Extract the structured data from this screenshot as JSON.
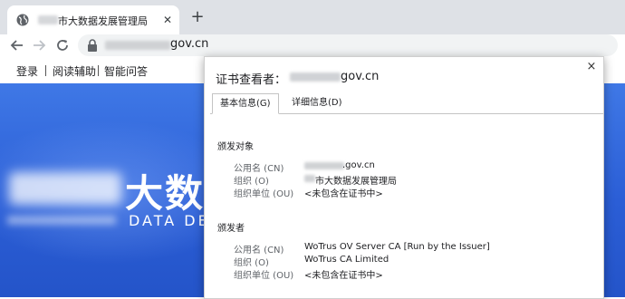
{
  "browser": {
    "tab": {
      "title": "市大数据发展管理局"
    },
    "new_tab_symbol": "+",
    "nav": {
      "back": "←",
      "forward": "→",
      "reload": "C"
    },
    "address": {
      "domain": "gov.cn"
    }
  },
  "page": {
    "topnav": [
      "登录",
      "阅读辅助",
      "智能问答"
    ],
    "hero": {
      "title": "大数",
      "subtitle": "DATA DEV"
    }
  },
  "cert_viewer": {
    "title_prefix": "证书查看者：",
    "title_domain": "gov.cn",
    "close": "×",
    "tabs": [
      {
        "label": "基本信息(G)",
        "active": true
      },
      {
        "label": "详细信息(D)",
        "active": false
      }
    ],
    "subject": {
      "section_title": "颁发对象",
      "fields": [
        {
          "label": "公用名 (CN)",
          "value": ".gov.cn"
        },
        {
          "label": "组织 (O)",
          "value": "市大数据发展管理局"
        },
        {
          "label": "组织单位 (OU)",
          "value": "<未包含在证书中>"
        }
      ]
    },
    "issuer": {
      "section_title": "颁发者",
      "fields": [
        {
          "label": "公用名 (CN)",
          "value": "WoTrus OV Server CA  [Run by the Issuer]"
        },
        {
          "label": "组织 (O)",
          "value": "WoTrus CA Limited"
        },
        {
          "label": "组织单位 (OU)",
          "value": "<未包含在证书中>"
        }
      ]
    }
  }
}
